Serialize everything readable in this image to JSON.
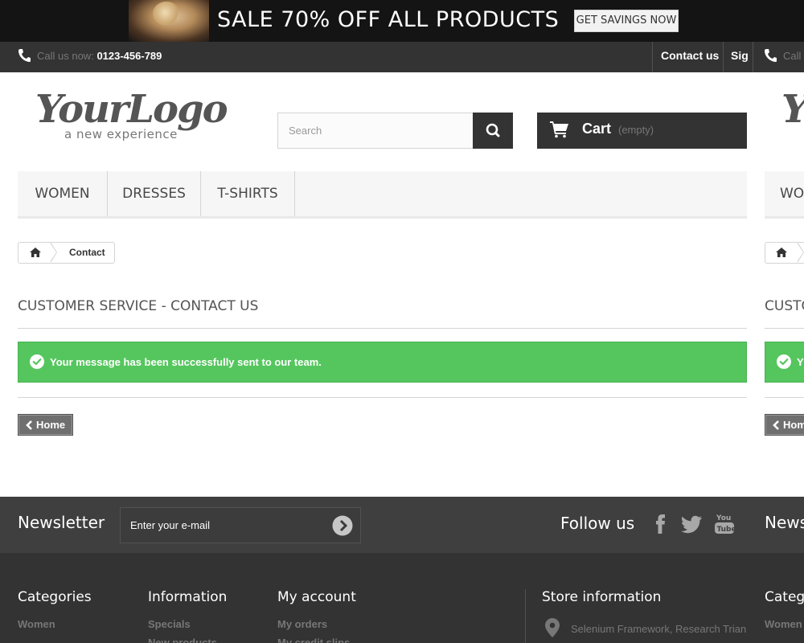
{
  "promo": {
    "text": "SALE 70% OFF ALL PRODUCTS",
    "button": "GET SAVINGS NOW"
  },
  "topnav": {
    "call_label": "Call us now:",
    "phone": "0123-456-789",
    "contact_link": "Contact us",
    "signin_link": "Sig",
    "dup_call": "Call"
  },
  "header": {
    "logo_script": "YourLogo",
    "logo_tagline": "a new experience",
    "logo_dup": "Y",
    "search_placeholder": "Search",
    "cart_label": "Cart",
    "cart_status": "(empty)"
  },
  "menu": {
    "items": [
      "WOMEN",
      "DRESSES",
      "T-SHIRTS"
    ],
    "dup": "WO"
  },
  "breadcrumb": {
    "current": "Contact"
  },
  "page": {
    "heading": "CUSTOMER SERVICE - CONTACT US",
    "heading_dup": "CUSTO",
    "success_message": "Your message has been successfully sent to our team.",
    "success_dup": "Y",
    "home_button": "Home",
    "home_dup": "Hom"
  },
  "newsletter": {
    "title": "Newsletter",
    "title_dup": "News",
    "placeholder": "Enter your e-mail",
    "follow": "Follow us",
    "social": [
      "facebook",
      "twitter",
      "youtube"
    ]
  },
  "footer": {
    "categories_title": "Categories",
    "categories_title_dup": "Categ",
    "categories_item": "Women",
    "categories_item_dup": "Women",
    "information_title": "Information",
    "information_item": "Specials",
    "information_item2": "New products",
    "account_title": "My account",
    "account_item": "My orders",
    "account_item2": "My credit slips",
    "store_title": "Store information",
    "store_address": "Selenium Framework, Research Trian"
  },
  "colors": {
    "dark": "#333333",
    "success": "#55c65e",
    "menu_bg": "#f6f6f6",
    "newsletter_bg": "#3f3f3f"
  }
}
